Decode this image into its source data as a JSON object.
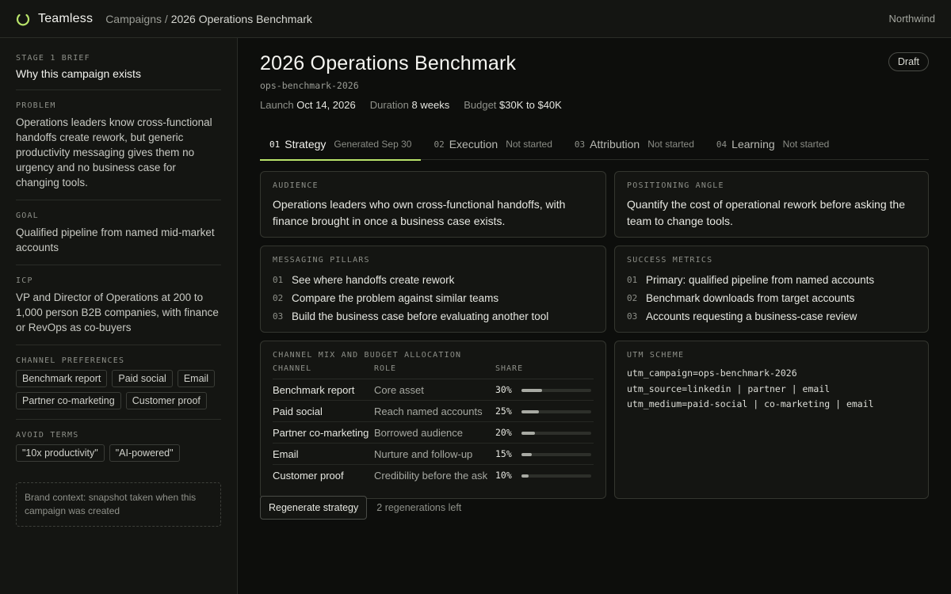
{
  "app": {
    "brand": "Teamless",
    "workspace": "Northwind",
    "accent": "#b8e36a"
  },
  "breadcrumb": {
    "parent": "Campaigns",
    "separator": " / ",
    "current": "2026 Operations Benchmark"
  },
  "sidebar": {
    "brief_label": "STAGE 1 BRIEF",
    "brief_title": "Why this campaign exists",
    "problem_label": "PROBLEM",
    "problem": "Operations leaders know cross-functional handoffs create rework, but generic productivity messaging gives them no urgency and no business case for changing tools.",
    "goal_label": "GOAL",
    "goal": "Qualified pipeline from named mid-market accounts",
    "icp_label": "ICP",
    "icp": "VP and Director of Operations at 200 to 1,000 person B2B companies, with finance or RevOps as co-buyers",
    "channels_label": "CHANNEL PREFERENCES",
    "channels": [
      "Benchmark report",
      "Paid social",
      "Email",
      "Partner co-marketing",
      "Customer proof"
    ],
    "avoid_label": "AVOID TERMS",
    "avoid": [
      "\"10x productivity\"",
      "\"AI-powered\""
    ],
    "brand_note": "Brand context: snapshot taken when this campaign was created"
  },
  "campaign": {
    "title": "2026 Operations Benchmark",
    "status": "Draft",
    "slug": "ops-benchmark-2026",
    "launch_label": "Launch",
    "launch": "Oct 14, 2026",
    "duration_label": "Duration",
    "duration": "8 weeks",
    "budget_label": "Budget",
    "budget": "$30K to $40K"
  },
  "tabs": [
    {
      "num": "01",
      "name": "Strategy",
      "status": "Generated Sep 30",
      "active": true
    },
    {
      "num": "02",
      "name": "Execution",
      "status": "Not started"
    },
    {
      "num": "03",
      "name": "Attribution",
      "status": "Not started"
    },
    {
      "num": "04",
      "name": "Learning",
      "status": "Not started"
    }
  ],
  "audience": {
    "label": "AUDIENCE",
    "text": "Operations leaders who own cross-functional handoffs, with finance brought in once a business case exists."
  },
  "positioning": {
    "label": "POSITIONING ANGLE",
    "text": "Quantify the cost of operational rework before asking the team to change tools."
  },
  "pillars": {
    "label": "MESSAGING PILLARS",
    "items": [
      {
        "n": "01",
        "text": "See where handoffs create rework"
      },
      {
        "n": "02",
        "text": "Compare the problem against similar teams"
      },
      {
        "n": "03",
        "text": "Build the business case before evaluating another tool"
      }
    ]
  },
  "metrics": {
    "label": "SUCCESS METRICS",
    "items": [
      {
        "n": "01",
        "text": "Primary: qualified pipeline from named accounts"
      },
      {
        "n": "02",
        "text": "Benchmark downloads from target accounts"
      },
      {
        "n": "03",
        "text": "Accounts requesting a business-case review"
      }
    ]
  },
  "channel_mix": {
    "label": "CHANNEL MIX AND BUDGET ALLOCATION",
    "headers": {
      "channel": "CHANNEL",
      "role": "ROLE",
      "share": "SHARE"
    },
    "rows": [
      {
        "channel": "Benchmark report",
        "role": "Core asset",
        "share": "30%",
        "value": 30
      },
      {
        "channel": "Paid social",
        "role": "Reach named accounts",
        "share": "25%",
        "value": 25
      },
      {
        "channel": "Partner co-marketing",
        "role": "Borrowed audience",
        "share": "20%",
        "value": 20
      },
      {
        "channel": "Email",
        "role": "Nurture and follow-up",
        "share": "15%",
        "value": 15
      },
      {
        "channel": "Customer proof",
        "role": "Credibility before the ask",
        "share": "10%",
        "value": 10
      }
    ]
  },
  "utm": {
    "label": "UTM SCHEME",
    "lines": [
      "utm_campaign=ops-benchmark-2026",
      "utm_source=linkedin | partner | email",
      "utm_medium=paid-social | co-marketing | email"
    ]
  },
  "actions": {
    "regenerate": "Regenerate strategy",
    "remaining": "2 regenerations left"
  }
}
